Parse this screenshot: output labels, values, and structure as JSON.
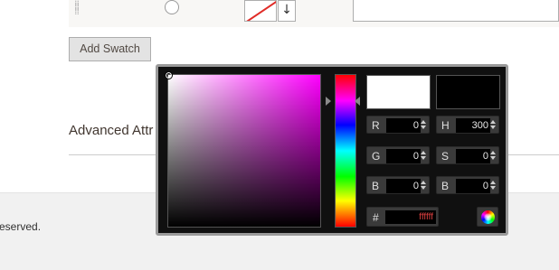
{
  "swatch_row": {
    "drag_icon": "drag-handle-icon",
    "arrow_icon": "arrow-down-icon"
  },
  "add_swatch": {
    "label": "Add Swatch"
  },
  "advanced": {
    "title": "Advanced Attr"
  },
  "footer": {
    "text": "eserved."
  },
  "color_picker": {
    "new_color": "#ffffff",
    "current_color": "#000000",
    "hue_colors": [
      "#ff0000",
      "#ff00ff",
      "#0000ff",
      "#00ffff",
      "#00ff00",
      "#ffff00",
      "#ff0000"
    ],
    "fields": {
      "r": {
        "label": "R",
        "value": "0"
      },
      "g": {
        "label": "G",
        "value": "0"
      },
      "b": {
        "label": "B",
        "value": "0"
      },
      "h": {
        "label": "H",
        "value": "300"
      },
      "s": {
        "label": "S",
        "value": "0"
      },
      "b2": {
        "label": "B",
        "value": "0"
      }
    },
    "hex": {
      "label": "#",
      "value": "ffffff"
    },
    "submit_icon": "color-wheel-icon"
  }
}
